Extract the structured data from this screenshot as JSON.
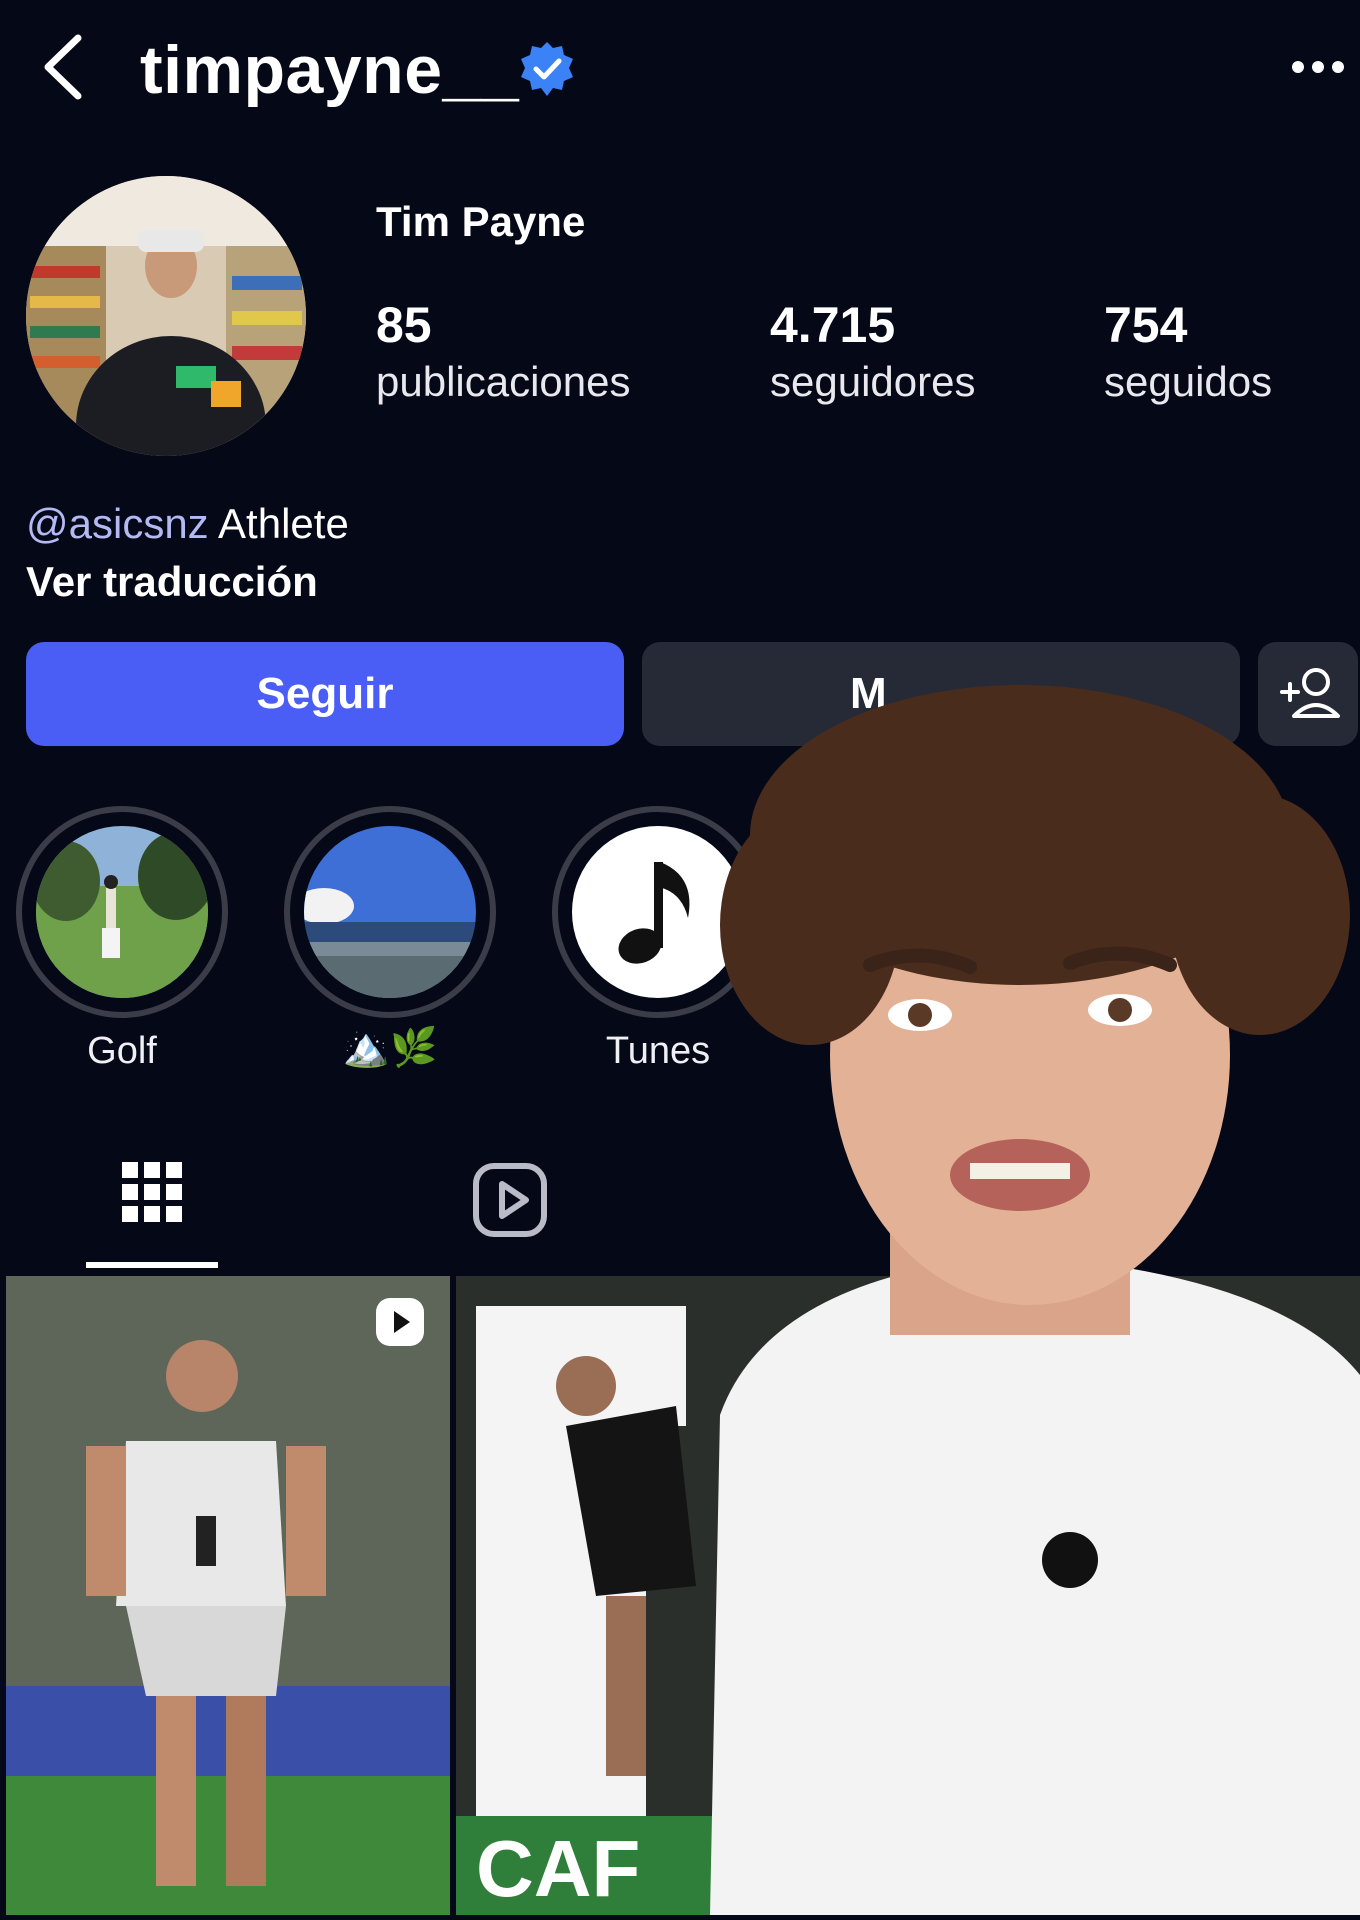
{
  "header": {
    "username": "timpayne__",
    "back_icon": "chevron-left-icon",
    "verified_icon": "verified-badge-icon",
    "more_icon": "more-horizontal-icon"
  },
  "profile": {
    "display_name": "Tim Payne",
    "stats": {
      "posts": {
        "value": "85",
        "label": "publicaciones"
      },
      "followers": {
        "value": "4.715",
        "label": "seguidores"
      },
      "following": {
        "value": "754",
        "label": "seguidos"
      }
    },
    "bio": {
      "mention": "@asicsnz",
      "text": "Athlete",
      "translate": "Ver traducción"
    }
  },
  "buttons": {
    "follow": "Seguir",
    "message": "M",
    "add_user_icon": "add-person-icon"
  },
  "highlights": [
    {
      "label": "Golf"
    },
    {
      "label": "🏔️🌿"
    },
    {
      "label": "Tunes"
    }
  ],
  "tabs": {
    "grid_icon": "grid-icon",
    "reels_icon": "reels-icon"
  },
  "posts": [
    {
      "type": "reel",
      "overlay_icon": "reel-play-icon"
    },
    {
      "type": "image",
      "overlay_text": "CAF"
    }
  ],
  "colors": {
    "background": "#050816",
    "follow_button": "#4a5df5",
    "secondary_button": "#262a36",
    "mention": "#b3b9f2",
    "verified": "#3b82f6"
  }
}
